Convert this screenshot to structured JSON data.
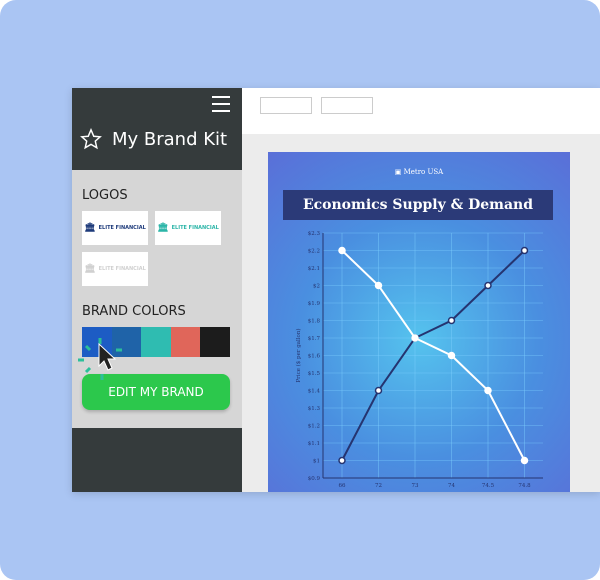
{
  "sidebar": {
    "title": "My Brand Kit",
    "logos_heading": "LOGOS",
    "logos": [
      {
        "text": "ELITE FINANCIAL",
        "color": "#1d3a7a"
      },
      {
        "text": "ELITE FINANCIAL",
        "color": "#2bb5a8"
      },
      {
        "text": "ELITE FINANCIAL",
        "color": "#d0d0d0"
      }
    ],
    "colors_heading": "BRAND COLORS",
    "colors": [
      "#1d5cc4",
      "#1f63a8",
      "#2fbcb1",
      "#e0665a",
      "#1c1c1c"
    ],
    "edit_button": "EDIT MY BRAND"
  },
  "poster": {
    "brand": "Metro USA",
    "title": "Economics Supply & Demand"
  },
  "chart_data": {
    "type": "line",
    "title": "Economics Supply & Demand",
    "ylabel": "Price ($ per gallon)",
    "xlabel": "",
    "categories": [
      "66",
      "72",
      "73",
      "74",
      "74.5",
      "74.8"
    ],
    "yticks": [
      "$0.9",
      "$1",
      "$1.1",
      "$1.2",
      "$1.3",
      "$1.4",
      "$1.5",
      "$1.6",
      "$1.7",
      "$1.8",
      "$1.9",
      "$2",
      "$2.1",
      "$2.2",
      "$2.3"
    ],
    "ylim": [
      0.9,
      2.3
    ],
    "grid": true,
    "series": [
      {
        "values": [
          1.0,
          1.4,
          1.7,
          1.8,
          2.0,
          2.2
        ],
        "color": "#253470"
      },
      {
        "values": [
          2.2,
          2.0,
          1.7,
          1.6,
          1.4,
          1.0
        ],
        "color": "#ffffff"
      }
    ]
  }
}
